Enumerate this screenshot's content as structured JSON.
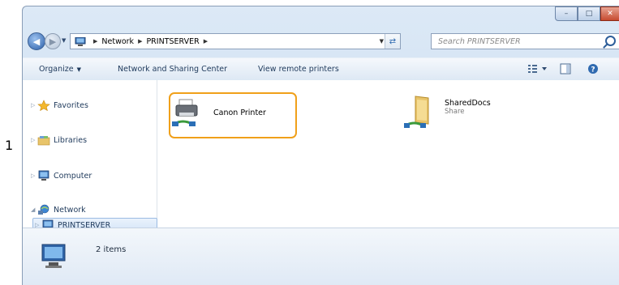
{
  "step_number": "1",
  "window": {
    "caption_buttons": [
      "minimize",
      "maximize",
      "close"
    ]
  },
  "address_bar": {
    "segments": [
      "Network",
      "PRINTSERVER"
    ],
    "search_placeholder": "Search PRINTSERVER"
  },
  "toolbar": {
    "organize_label": "Organize",
    "network_sharing_label": "Network and Sharing Center",
    "view_remote_label": "View remote printers"
  },
  "nav": {
    "favorites": "Favorites",
    "libraries": "Libraries",
    "computer": "Computer",
    "network": "Network",
    "printserver": "PRINTSERVER"
  },
  "items": [
    {
      "name": "Canon Printer",
      "sub": "",
      "icon": "printer-icon"
    },
    {
      "name": "SharedDocs",
      "sub": "Share",
      "icon": "shared-folder-icon"
    }
  ],
  "status": {
    "count_text": "2 items"
  },
  "colors": {
    "highlight": "#f0a01a",
    "accent": "#1e395b"
  }
}
